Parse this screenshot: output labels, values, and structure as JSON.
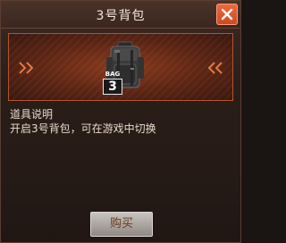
{
  "dialog": {
    "title": "3号背包",
    "close_icon": "close-icon"
  },
  "item": {
    "badge_label": "BAG",
    "badge_number": "3",
    "icon": "backpack-icon"
  },
  "description": {
    "heading": "道具说明",
    "text": "开启3号背包，可在游戏中切换"
  },
  "actions": {
    "buy_label": "购买"
  },
  "colors": {
    "close_button": "#e85a30",
    "banner_border": "#b1552d",
    "banner_center": "#8a3a1c",
    "chevron": "#e07a45"
  }
}
